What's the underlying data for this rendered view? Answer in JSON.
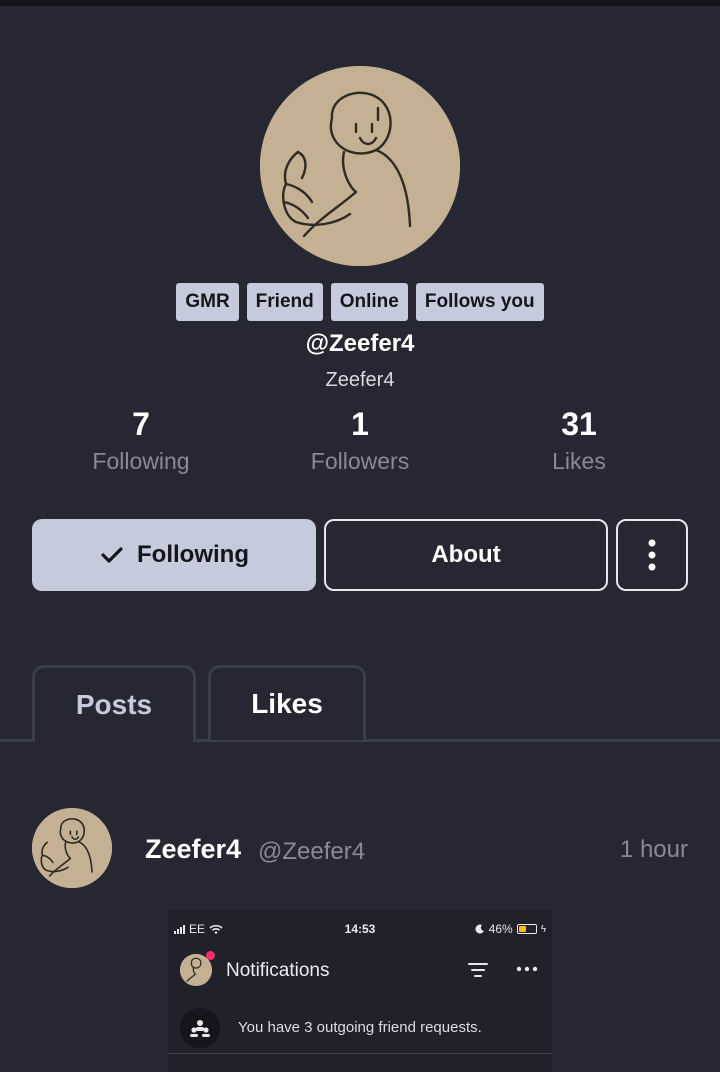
{
  "profile": {
    "badges": [
      "GMR",
      "Friend",
      "Online",
      "Follows you"
    ],
    "handle": "@Zeefer4",
    "display_name": "Zeefer4",
    "avatar_icon": "user-drawing-avatar"
  },
  "stats": {
    "following": {
      "value": "7",
      "label": "Following"
    },
    "followers": {
      "value": "1",
      "label": "Followers"
    },
    "likes": {
      "value": "31",
      "label": "Likes"
    }
  },
  "actions": {
    "following_label": "Following",
    "about_label": "About",
    "more_icon": "vertical-dots-icon",
    "check_icon": "checkmark-icon"
  },
  "tabs": [
    {
      "label": "Posts",
      "active": true
    },
    {
      "label": "Likes",
      "active": false
    }
  ],
  "post": {
    "author_name": "Zeefer4",
    "author_handle": "@Zeefer4",
    "time": "1 hour",
    "screenshot": {
      "carrier": "EE",
      "clock": "14:53",
      "battery": "46%",
      "battery_level": 0.46,
      "title": "Notifications",
      "notification": "You have 3 outgoing friend requests."
    }
  },
  "colors": {
    "background": "#272733",
    "badge": "#c5cbdc",
    "muted_text": "#8a8a96",
    "tab_border": "#3b3d4a",
    "notification_dot": "#ff2d6b"
  }
}
